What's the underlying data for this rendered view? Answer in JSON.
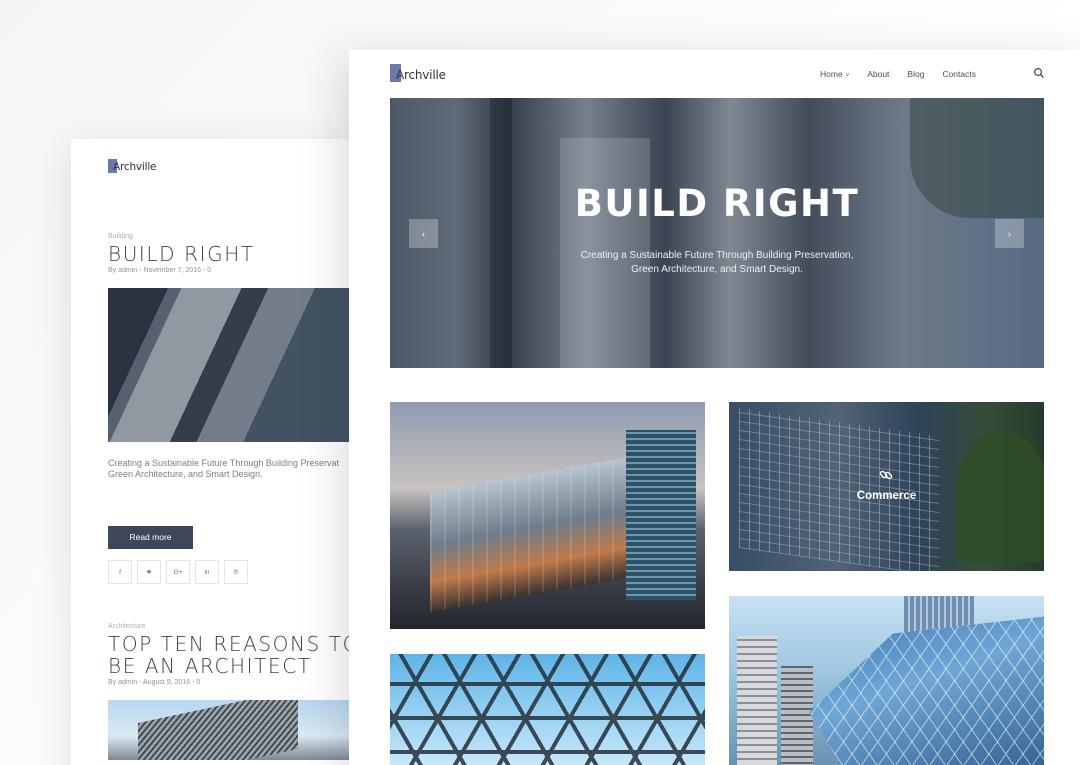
{
  "blog_page": {
    "logo": {
      "text": "Archville"
    },
    "posts": [
      {
        "category": "Building",
        "title": "BUILD RIGHT",
        "meta": "By admin - November 7, 2016 - 0",
        "excerpt": "Creating a Sustainable Future Through Building Preservat\nGreen Architecture, and Smart Design.",
        "read_more": "Read more",
        "social_links": [
          {
            "icon": "facebook-icon",
            "glyph": "f"
          },
          {
            "icon": "twitter-icon",
            "glyph": "❖"
          },
          {
            "icon": "google-plus-icon",
            "glyph": "G+"
          },
          {
            "icon": "linkedin-icon",
            "glyph": "in"
          },
          {
            "icon": "pinterest-icon",
            "glyph": "℗"
          }
        ]
      },
      {
        "category": "Architecture",
        "title_line1": "TOP TEN REASONS TO",
        "title_line2": "BE AN ARCHITECT",
        "meta": "By admin - August 9, 2016 - 0"
      }
    ]
  },
  "home_page": {
    "logo": {
      "text": "Archville"
    },
    "nav": [
      {
        "label": "Home",
        "has_dropdown": true,
        "chevron": "˅"
      },
      {
        "label": "About"
      },
      {
        "label": "Blog"
      },
      {
        "label": "Contacts"
      }
    ],
    "search_icon": "search-icon",
    "hero": {
      "title": "BUILD RIGHT",
      "subtitle": "Creating a Sustainable Future Through Building Preservation,\nGreen Architecture, and Smart Design.",
      "prev_glyph": "‹",
      "next_glyph": "›"
    },
    "portfolio": {
      "commerce_label": "Commerce"
    }
  },
  "colors": {
    "accent": "#3e4759",
    "logo_mark": "#6b7aa8",
    "text_dark": "#3a4152"
  }
}
